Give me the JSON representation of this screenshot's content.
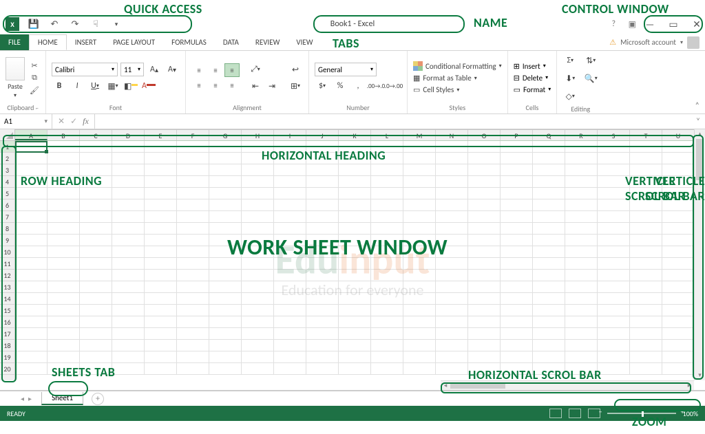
{
  "annotations": {
    "quick_access": "QUICK ACCESS",
    "name": "NAME",
    "control_window": "CONTROL WINDOW",
    "tabs": "TABS",
    "horizontal_heading": "HORIZONTAL HEADING",
    "row_heading": "ROW HEADING",
    "verticle_scrol_bar": "VERTICLE SCROL BAR",
    "work_sheet_window": "WORK SHEET WINDOW",
    "sheets_tab": "SHEETS TAB",
    "horizontal_scrol_bar": "HORIZONTAL SCROL BAR",
    "zoom": "ZOOM"
  },
  "title_bar": {
    "app_title": "Book1 - Excel"
  },
  "account": {
    "label": "Microsoft account"
  },
  "tabs": {
    "file": "FILE",
    "home": "HOME",
    "insert": "INSERT",
    "page_layout": "PAGE LAYOUT",
    "formulas": "FORMULAS",
    "data": "DATA",
    "review": "REVIEW",
    "view": "VIEW"
  },
  "ribbon": {
    "clipboard": {
      "label": "Clipboard",
      "paste": "Paste"
    },
    "font": {
      "label": "Font",
      "name": "Calibri",
      "size": "11",
      "b": "B",
      "i": "I",
      "u": "U"
    },
    "alignment": {
      "label": "Alignment"
    },
    "number": {
      "label": "Number",
      "format": "General",
      "currency": "$",
      "percent": "%",
      "comma": ","
    },
    "styles": {
      "label": "Styles",
      "cond": "Conditional Formatting",
      "table": "Format as Table",
      "cell": "Cell Styles"
    },
    "cells": {
      "label": "Cells",
      "insert": "Insert",
      "delete": "Delete",
      "format": "Format"
    },
    "editing": {
      "label": "Editing"
    }
  },
  "name_box": {
    "value": "A1"
  },
  "formula_bar": {
    "fx": "fx"
  },
  "columns": [
    "A",
    "B",
    "C",
    "D",
    "E",
    "F",
    "G",
    "H",
    "I",
    "J",
    "K",
    "L",
    "M",
    "N",
    "O",
    "P",
    "Q",
    "R",
    "S",
    "T",
    "U"
  ],
  "rows": [
    "1",
    "2",
    "3",
    "4",
    "5",
    "6",
    "7",
    "8",
    "9",
    "10",
    "11",
    "12",
    "13",
    "14",
    "15",
    "16",
    "17",
    "18",
    "19",
    "20"
  ],
  "sheets": {
    "sheet1": "Sheet1"
  },
  "status": {
    "ready": "READY",
    "zoom": "100%"
  },
  "watermark": {
    "edu": "Edu",
    "input": "input",
    "sub": "Education for everyone"
  }
}
